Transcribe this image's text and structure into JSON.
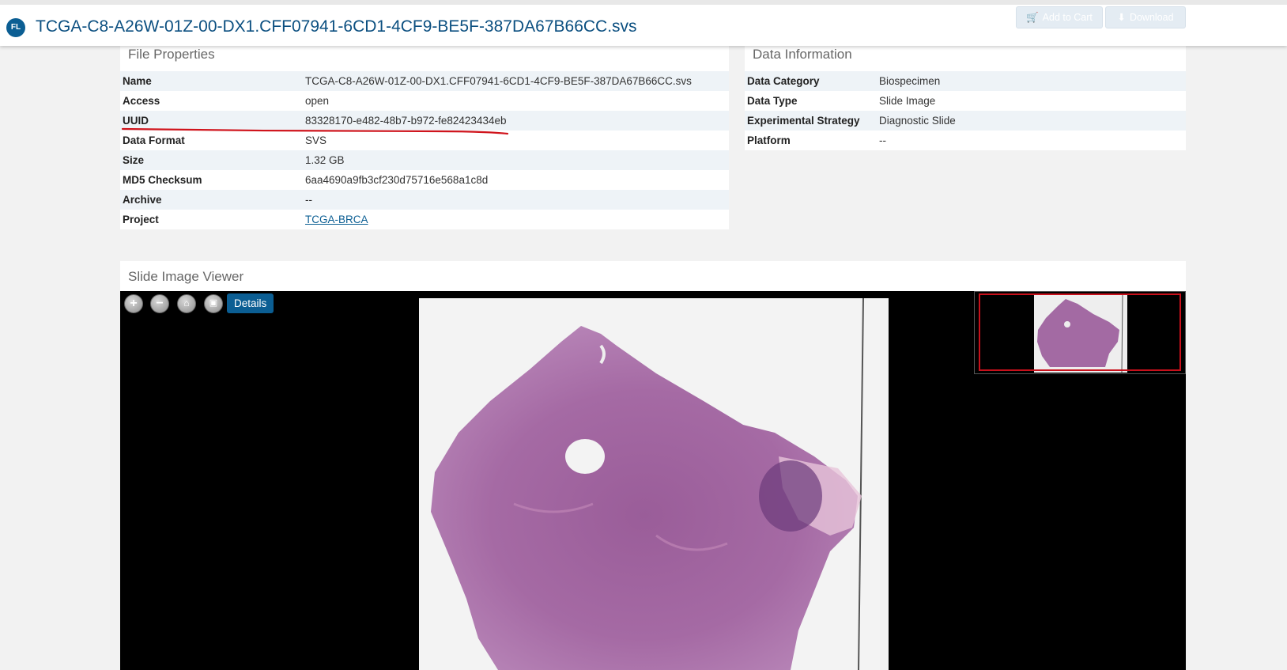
{
  "header": {
    "badge": "FL",
    "title": "TCGA-C8-A26W-01Z-00-DX1.CFF07941-6CD1-4CF9-BE5F-387DA67B66CC.svs",
    "add_to_cart": "Add to Cart",
    "download": "Download",
    "cart_icon": "shopping-cart-icon",
    "download_icon": "download-icon"
  },
  "file_properties": {
    "title": "File Properties",
    "rows": [
      {
        "key": "Name",
        "value": "TCGA-C8-A26W-01Z-00-DX1.CFF07941-6CD1-4CF9-BE5F-387DA67B66CC.svs"
      },
      {
        "key": "Access",
        "value": "open"
      },
      {
        "key": "UUID",
        "value": "83328170-e482-48b7-b972-fe82423434eb"
      },
      {
        "key": "Data Format",
        "value": "SVS"
      },
      {
        "key": "Size",
        "value": "1.32 GB"
      },
      {
        "key": "MD5 Checksum",
        "value": "6aa4690a9fb3cf230d75716e568a1c8d"
      },
      {
        "key": "Archive",
        "value": "--"
      },
      {
        "key": "Project",
        "value": "TCGA-BRCA"
      }
    ]
  },
  "data_information": {
    "title": "Data Information",
    "rows": [
      {
        "key": "Data Category",
        "value": "Biospecimen"
      },
      {
        "key": "Data Type",
        "value": "Slide Image"
      },
      {
        "key": "Experimental Strategy",
        "value": "Diagnostic Slide"
      },
      {
        "key": "Platform",
        "value": "--"
      }
    ]
  },
  "viewer": {
    "title": "Slide Image Viewer",
    "details_label": "Details",
    "controls": [
      "zoom-in-icon",
      "zoom-out-icon",
      "home-icon",
      "fullscreen-icon"
    ]
  },
  "colors": {
    "brand": "#0b5e93",
    "annotation_underline": "#d0141c",
    "navigator_box": "#c8101b"
  }
}
